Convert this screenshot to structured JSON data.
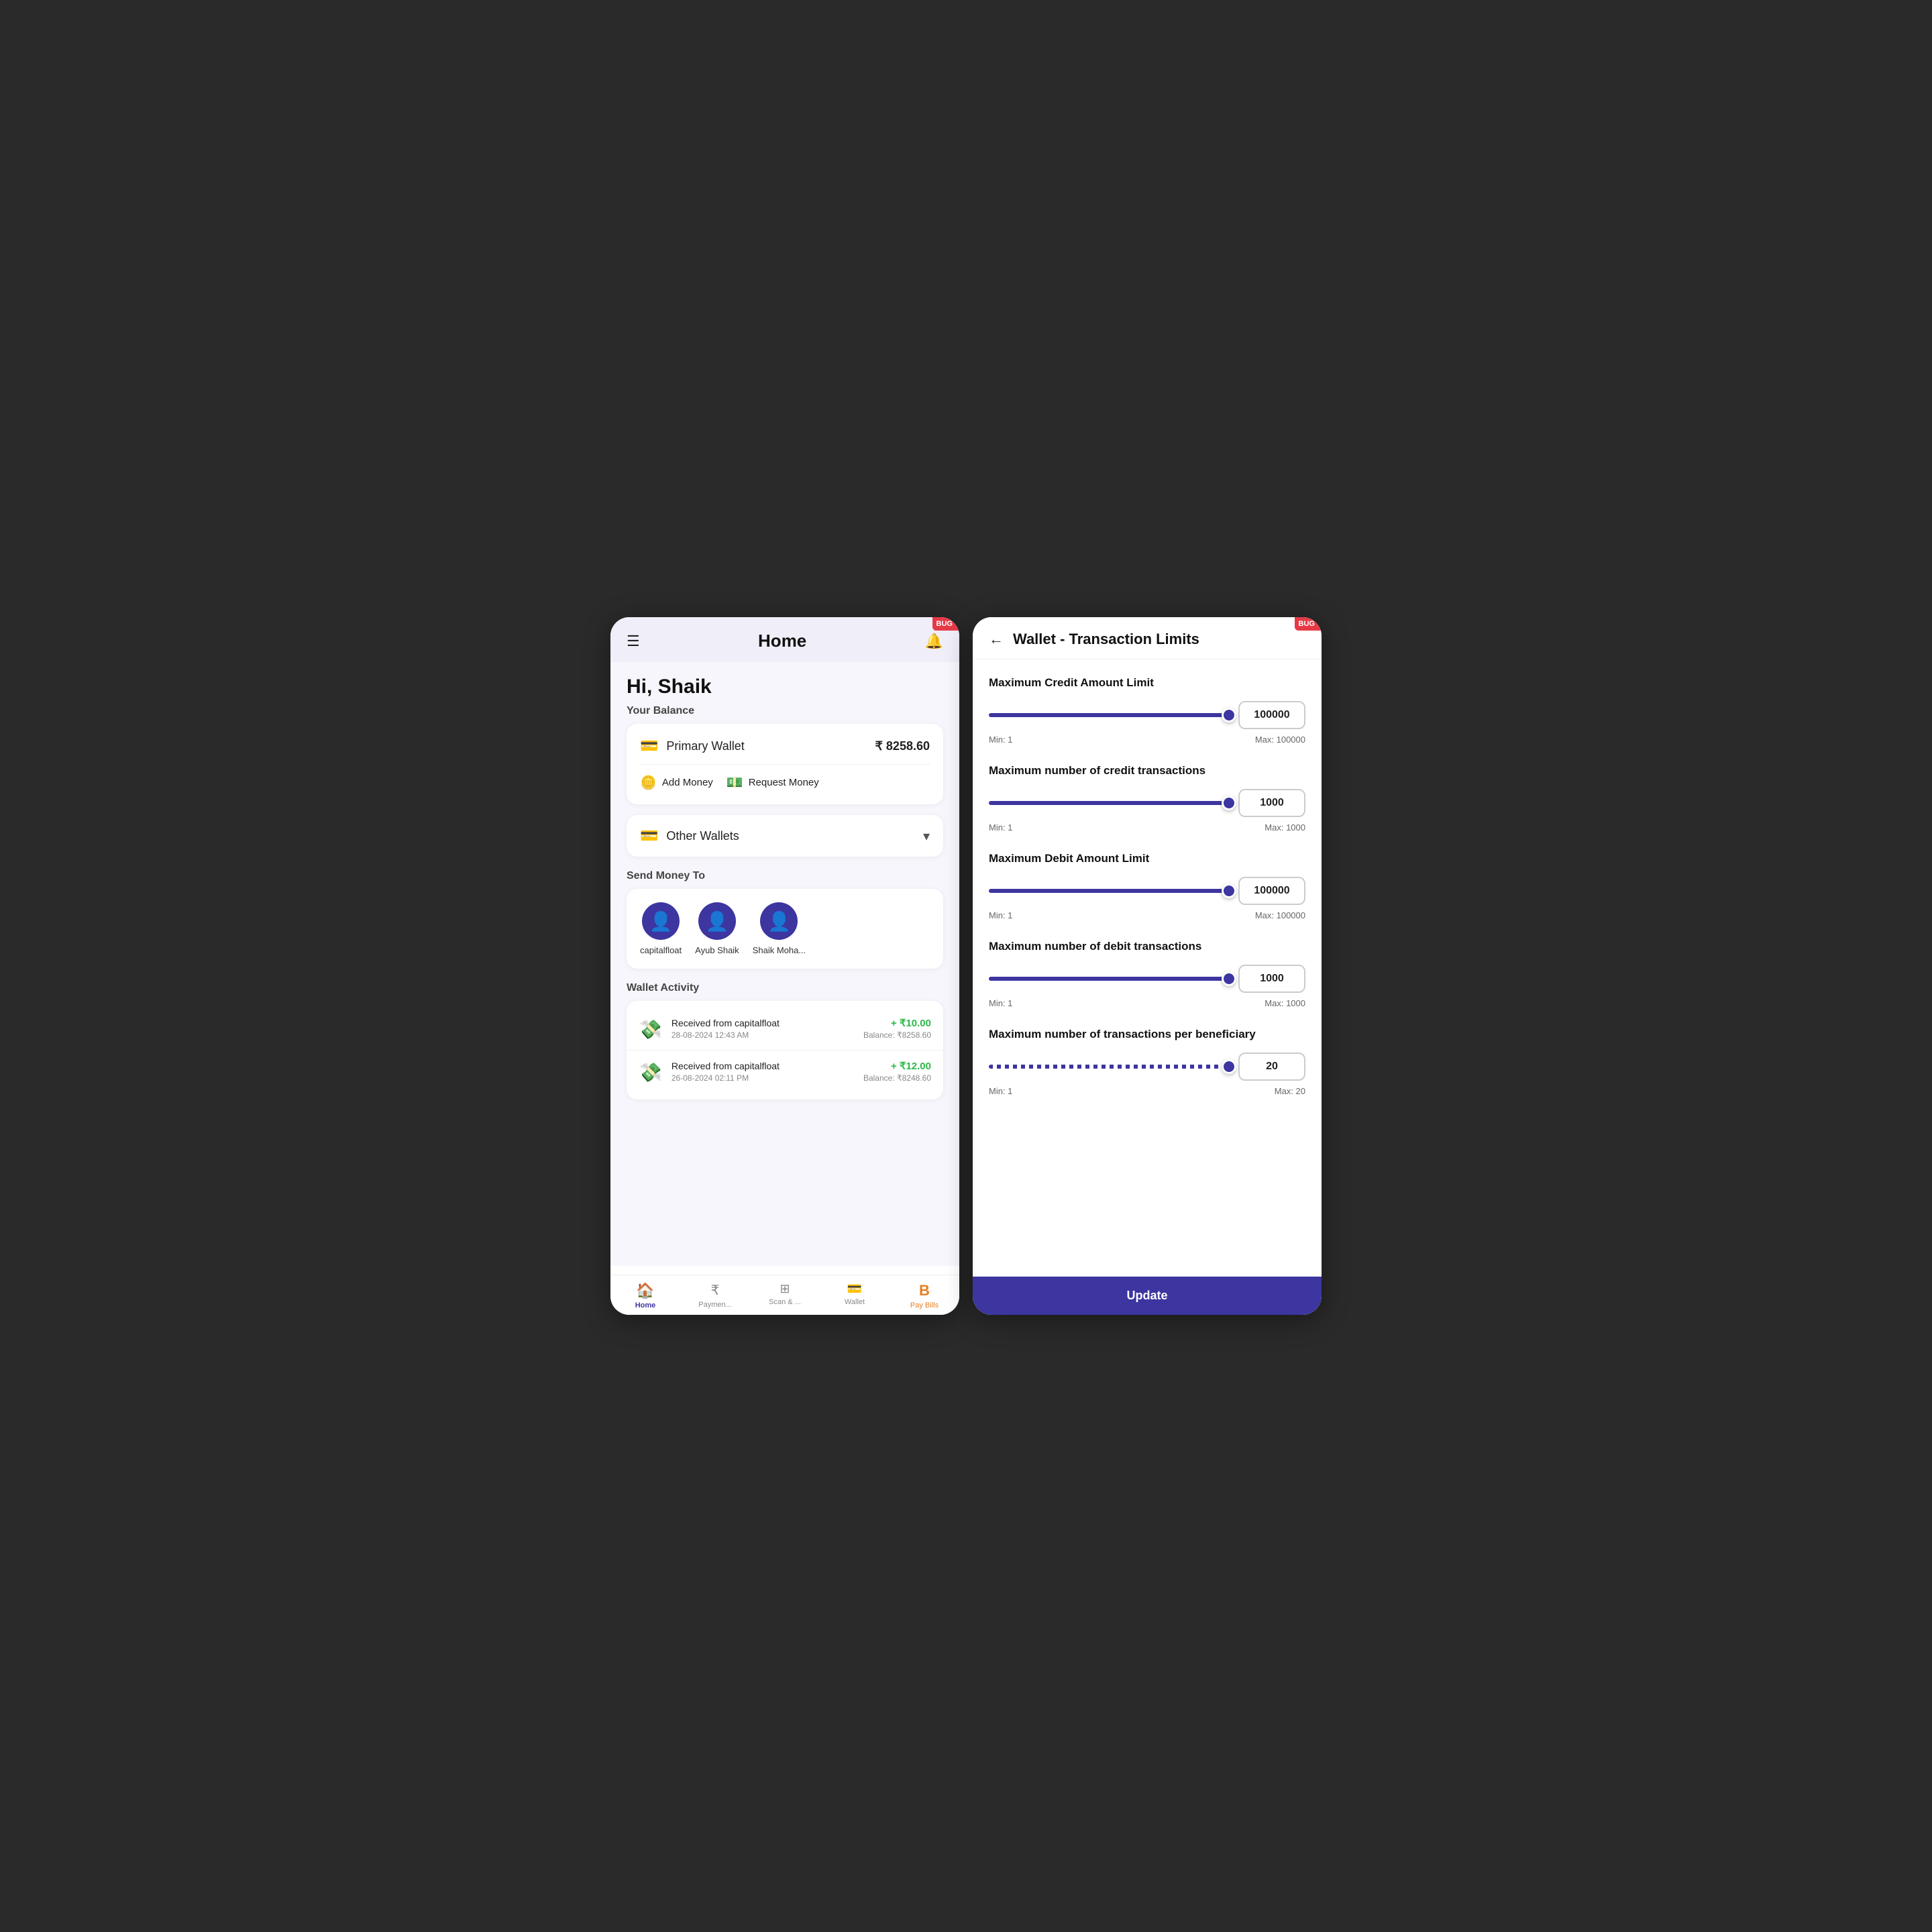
{
  "screen1": {
    "header": {
      "title": "Home",
      "hamburger_label": "☰",
      "bell_label": "🔔"
    },
    "greeting": "Hi, Shaik",
    "balance_section_label": "Your Balance",
    "primary_wallet": {
      "icon": "🪪",
      "label": "Primary Wallet",
      "amount": "₹ 8258.60"
    },
    "add_money_label": "Add Money",
    "request_money_label": "Request Money",
    "other_wallets_label": "Other Wallets",
    "send_money_label": "Send Money To",
    "contacts": [
      {
        "name": "capitalfloat"
      },
      {
        "name": "Ayub Shaik"
      },
      {
        "name": "Shaik Moha..."
      }
    ],
    "activity_label": "Wallet Activity",
    "transactions": [
      {
        "title": "Received from capitalfloat",
        "date": "28-08-2024 12:43 AM",
        "amount": "+ ₹10.00",
        "balance": "Balance: ₹8258.60"
      },
      {
        "title": "Received from capitalfloat",
        "date": "26-08-2024 02:11 PM",
        "amount": "+ ₹12.00",
        "balance": "Balance: ₹8248.60"
      }
    ],
    "nav": [
      {
        "icon": "🏠",
        "label": "Home",
        "active": true
      },
      {
        "icon": "₹",
        "label": "Paymen...",
        "active": false
      },
      {
        "icon": "⊞",
        "label": "Scan & ...",
        "active": false
      },
      {
        "icon": "🪪",
        "label": "Wallet",
        "active": false
      },
      {
        "icon": "B",
        "label": "Pay Bills",
        "active": false,
        "special": "paybills"
      }
    ]
  },
  "screen2": {
    "header": {
      "back_label": "←",
      "title": "Wallet - Transaction Limits"
    },
    "limits": [
      {
        "label": "Maximum Credit Amount Limit",
        "value": "100000",
        "min": "Min: 1",
        "max": "Max: 100000",
        "percent": 100,
        "dotted": false
      },
      {
        "label": "Maximum number of credit transactions",
        "value": "1000",
        "min": "Min: 1",
        "max": "Max: 1000",
        "percent": 100,
        "dotted": false
      },
      {
        "label": "Maximum Debit Amount Limit",
        "value": "100000",
        "min": "Min: 1",
        "max": "Max: 100000",
        "percent": 100,
        "dotted": false
      },
      {
        "label": "Maximum number of debit transactions",
        "value": "1000",
        "min": "Min: 1",
        "max": "Max: 1000",
        "percent": 100,
        "dotted": false
      },
      {
        "label": "Maximum number of transactions per beneficiary",
        "value": "20",
        "min": "Min: 1",
        "max": "Max: 20",
        "percent": 100,
        "dotted": true
      }
    ],
    "update_button_label": "Update"
  }
}
